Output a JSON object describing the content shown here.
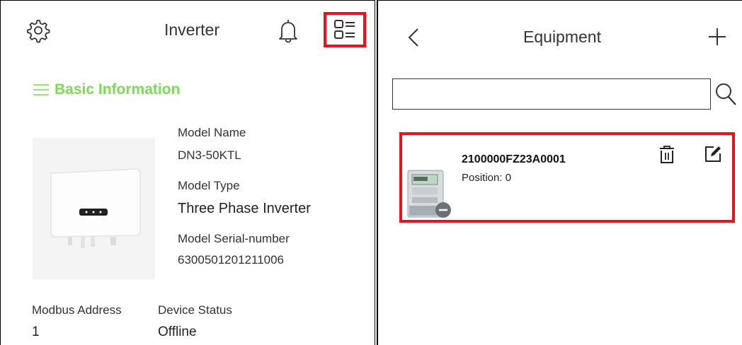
{
  "left": {
    "title": "Inverter",
    "section_title": "Basic Information",
    "model_name_label": "Model Name",
    "model_name_value": "DN3-50KTL",
    "model_type_label": "Model Type",
    "model_type_value": "Three Phase Inverter",
    "serial_label": "Model Serial-number",
    "serial_value": "6300501201211006",
    "modbus_label": "Modbus Address",
    "modbus_value": "1",
    "status_label": "Device Status",
    "status_value": "Offline"
  },
  "right": {
    "title": "Equipment",
    "search_value": "",
    "items": [
      {
        "id": "2100000FZ23A0001",
        "position": "Position: 0"
      }
    ]
  },
  "colors": {
    "accent_green": "#7ed957",
    "highlight_red": "#e8141c"
  },
  "icons": [
    "gear-icon",
    "bell-icon",
    "list-menu-icon",
    "menu-lines-icon",
    "back-chevron-icon",
    "plus-icon",
    "search-icon",
    "trash-icon",
    "edit-icon",
    "minus-badge-icon"
  ]
}
